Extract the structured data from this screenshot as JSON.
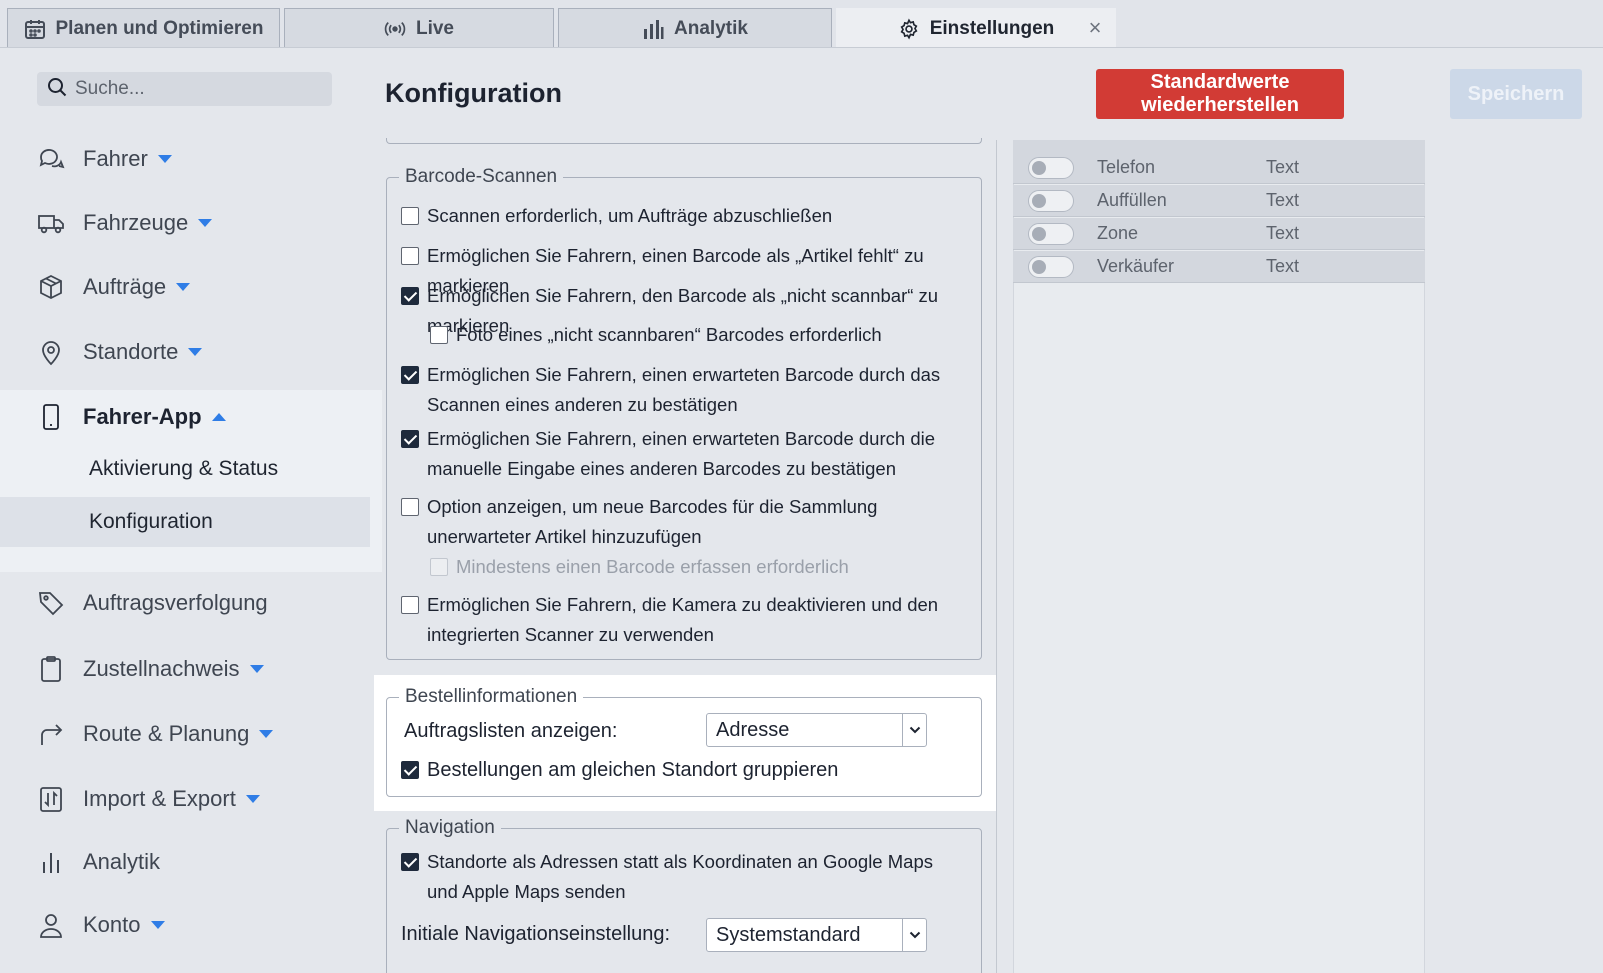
{
  "tabs": [
    {
      "label": "Planen und Optimieren",
      "icon": "calendar-icon"
    },
    {
      "label": "Live",
      "icon": "broadcast-icon"
    },
    {
      "label": "Analytik",
      "icon": "bar-chart-icon"
    },
    {
      "label": "Einstellungen",
      "icon": "gear-icon",
      "active": true,
      "close": "×"
    }
  ],
  "sidebar": {
    "search_placeholder": "Suche...",
    "items": [
      {
        "label": "Fahrer",
        "icon": "chat-bubbles-icon"
      },
      {
        "label": "Fahrzeuge",
        "icon": "truck-icon"
      },
      {
        "label": "Aufträge",
        "icon": "package-icon"
      },
      {
        "label": "Standorte",
        "icon": "map-pin-icon"
      },
      {
        "label": "Fahrer-App",
        "icon": "smartphone-icon"
      },
      {
        "label": "Auftragsverfolgung",
        "icon": "tag-icon"
      },
      {
        "label": "Zustellnachweis",
        "icon": "clipboard-icon"
      },
      {
        "label": "Route & Planung",
        "icon": "route-arrow-icon"
      },
      {
        "label": "Import & Export",
        "icon": "import-export-icon"
      },
      {
        "label": "Analytik",
        "icon": "bar-chart-icon"
      },
      {
        "label": "Konto",
        "icon": "user-icon"
      }
    ],
    "subitems": [
      {
        "label": "Aktivierung & Status"
      },
      {
        "label": "Konfiguration",
        "selected": true
      }
    ]
  },
  "header": {
    "title": "Konfiguration",
    "reset_label": "Standardwerte wiederherstellen",
    "save_label": "Speichern"
  },
  "barcode": {
    "legend": "Barcode-Scannen",
    "options": [
      {
        "text": "Scannen erforderlich, um Aufträge abzuschließen",
        "checked": false
      },
      {
        "text": "Ermöglichen Sie Fahrern, einen Barcode als „Artikel fehlt“ zu markieren",
        "checked": false
      },
      {
        "text": "Ermöglichen Sie Fahrern, den Barcode als „nicht scannbar“ zu markieren",
        "checked": true
      },
      {
        "text": "Foto eines „nicht scannbaren“ Barcodes erforderlich",
        "checked": false
      },
      {
        "text": "Ermöglichen Sie Fahrern, einen erwarteten Barcode durch das Scannen eines anderen zu bestätigen",
        "checked": true
      },
      {
        "text": "Ermöglichen Sie Fahrern, einen erwarteten Barcode durch die manuelle Eingabe eines anderen Barcodes zu bestätigen",
        "checked": true
      },
      {
        "text": "Option anzeigen, um neue Barcodes für die Sammlung unerwarteter Artikel hinzuzufügen",
        "checked": false
      },
      {
        "text": "Mindestens einen Barcode erfassen erforderlich",
        "checked": false,
        "disabled": true
      },
      {
        "text": "Ermöglichen Sie Fahrern, die Kamera zu deaktivieren und den integrierten Scanner zu verwenden",
        "checked": false
      }
    ]
  },
  "order_info": {
    "legend": "Bestellinformationen",
    "list_label": "Auftragslisten anzeigen:",
    "list_value": "Adresse",
    "group_label": "Bestellungen am gleichen Standort gruppieren",
    "group_checked": true
  },
  "navigation": {
    "legend": "Navigation",
    "send_label": "Standorte als Adressen statt als Koordinaten an Google Maps und Apple Maps senden",
    "send_checked": true,
    "initial_label": "Initiale Navigationseinstellung:",
    "initial_value": "Systemstandard"
  },
  "fields": [
    {
      "name": "Telefon",
      "type": "Text",
      "enabled": false
    },
    {
      "name": "Auffüllen",
      "type": "Text",
      "enabled": false
    },
    {
      "name": "Zone",
      "type": "Text",
      "enabled": false
    },
    {
      "name": "Verkäufer",
      "type": "Text",
      "enabled": false
    }
  ],
  "colors": {
    "accent": "#2f7de6",
    "danger": "#d23b35",
    "save_disabled": "#ccd8e8"
  }
}
